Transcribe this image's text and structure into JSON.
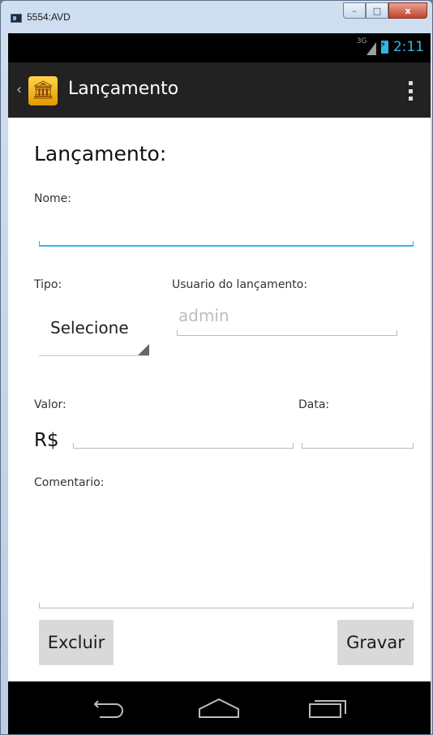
{
  "window": {
    "title": "5554:AVD",
    "minimize": "–",
    "maximize": "□",
    "close": "x"
  },
  "statusbar": {
    "network": "3G",
    "time": "2:11"
  },
  "actionbar": {
    "title": "Lançamento",
    "app_icon": "bank-icon"
  },
  "form": {
    "heading": "Lançamento:",
    "nome_label": "Nome:",
    "nome_value": "",
    "tipo_label": "Tipo:",
    "tipo_selected": "Selecione",
    "usuario_label": "Usuario do lançamento:",
    "usuario_hint": "admin",
    "valor_label": "Valor:",
    "currency": "R$",
    "valor_value": "",
    "data_label": "Data:",
    "data_value": "",
    "comentario_label": "Comentario:",
    "comentario_value": ""
  },
  "buttons": {
    "excluir": "Excluir",
    "gravar": "Gravar"
  },
  "navbar": {
    "back": "back-icon",
    "home": "home-icon",
    "recents": "recents-icon"
  },
  "colors": {
    "accent": "#33b5e5",
    "actionbar": "#222222",
    "button": "#d9d9d9"
  }
}
